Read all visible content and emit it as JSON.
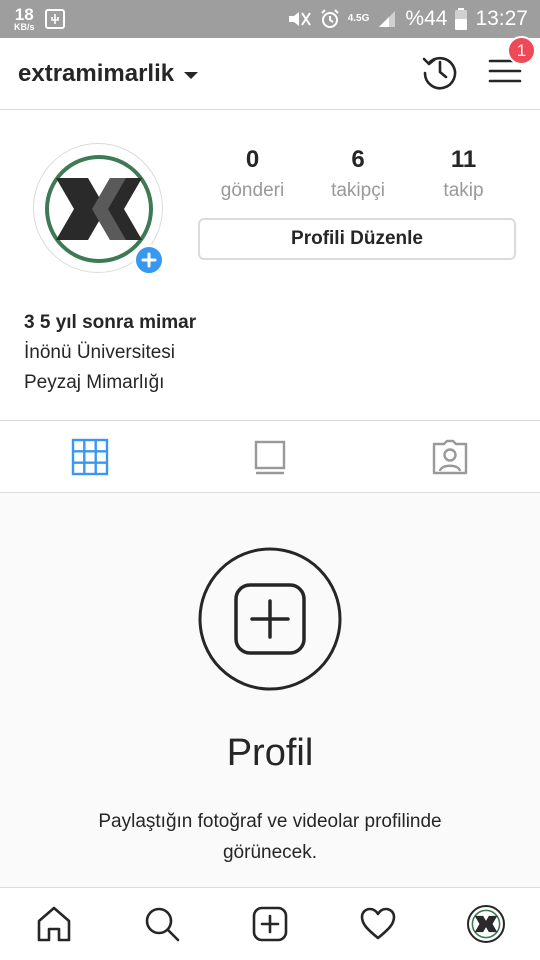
{
  "status_bar": {
    "speed_value": "18",
    "speed_unit": "KB/s",
    "network": "4.5G",
    "battery": "%44",
    "time": "13:27"
  },
  "header": {
    "username": "extramimarlik",
    "notification_count": "1",
    "icons": [
      "history-icon",
      "menu-icon"
    ]
  },
  "profile": {
    "stats": [
      {
        "value": "0",
        "label": "gönderi"
      },
      {
        "value": "6",
        "label": "takipçi"
      },
      {
        "value": "11",
        "label": "takip"
      }
    ],
    "edit_button": "Profili Düzenle",
    "bio": {
      "name": "3 5 yıl sonra mimar",
      "lines": [
        "İnönü Üniversitesi",
        "Peyzaj Mimarlığı"
      ]
    },
    "avatar_ring_color": "#3e7a55",
    "add_badge_color": "#3897f0"
  },
  "tabs": [
    {
      "icon": "grid-icon",
      "active": true
    },
    {
      "icon": "feed-icon",
      "active": false
    },
    {
      "icon": "tagged-icon",
      "active": false
    }
  ],
  "empty_state": {
    "title": "Profil",
    "description": "Paylaştığın fotoğraf ve videolar profilinde görünecek."
  },
  "bottom_nav": [
    "home-icon",
    "search-icon",
    "add-post-icon",
    "heart-icon",
    "profile-avatar"
  ],
  "colors": {
    "accent": "#3897f0",
    "badge": "#ed4956",
    "text": "#262626",
    "muted": "#999999"
  }
}
